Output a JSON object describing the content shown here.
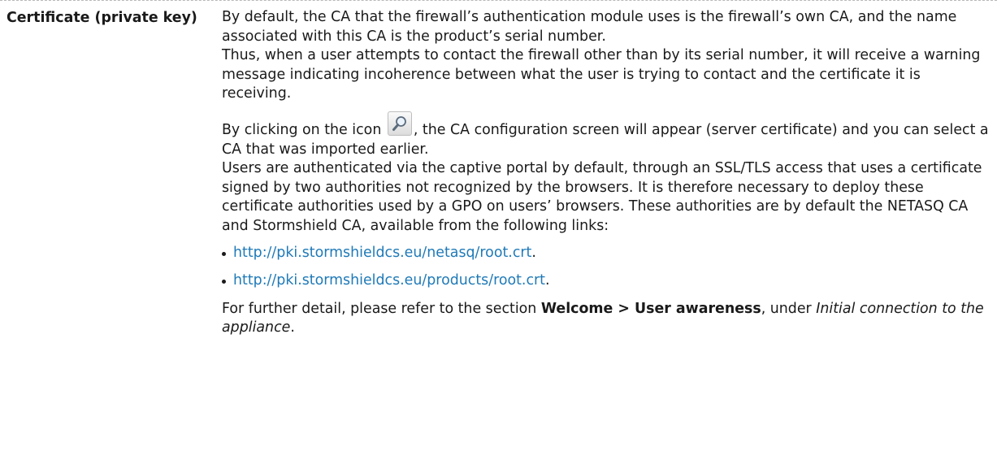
{
  "term": "Certificate (private key)",
  "para1": [
    "By default, the CA that the firewall’s authentication module uses is the firewall’s own CA, and the name associated with this CA is the product’s serial number.",
    "Thus, when a user attempts to contact the firewall other than by its serial number, it will receive a warning message indicating incoherence between what the user is trying to contact and the certificate it is receiving."
  ],
  "para2": {
    "before_icon": "By clicking on the icon ",
    "icon": "magnifier-icon",
    "after_icon": ", the CA configuration screen will appear (server certificate) and you can select a CA that was imported earlier."
  },
  "para3": "Users are authenticated via the captive portal by default, through an SSL/TLS access that uses a certificate signed by two authorities not recognized by the browsers. It is therefore necessary to deploy these certificate authorities used by a GPO on users’ browsers. These authorities are by default the NETASQ CA and Stormshield CA, available from the following links:",
  "links": [
    {
      "url": "http://pki.stormshieldcs.eu/netasq/root.crt",
      "suffix": "."
    },
    {
      "url": "http://pki.stormshieldcs.eu/products/root.crt",
      "suffix": "."
    }
  ],
  "final": {
    "lead": "For further detail, please refer to the section ",
    "section": "Welcome > User awareness",
    "mid": ", under ",
    "chapter": "Initial connection to the appliance",
    "end": "."
  },
  "colors": {
    "link": "#1f7ab8",
    "text": "#1a1a1a",
    "rule": "#b8b8b8"
  }
}
